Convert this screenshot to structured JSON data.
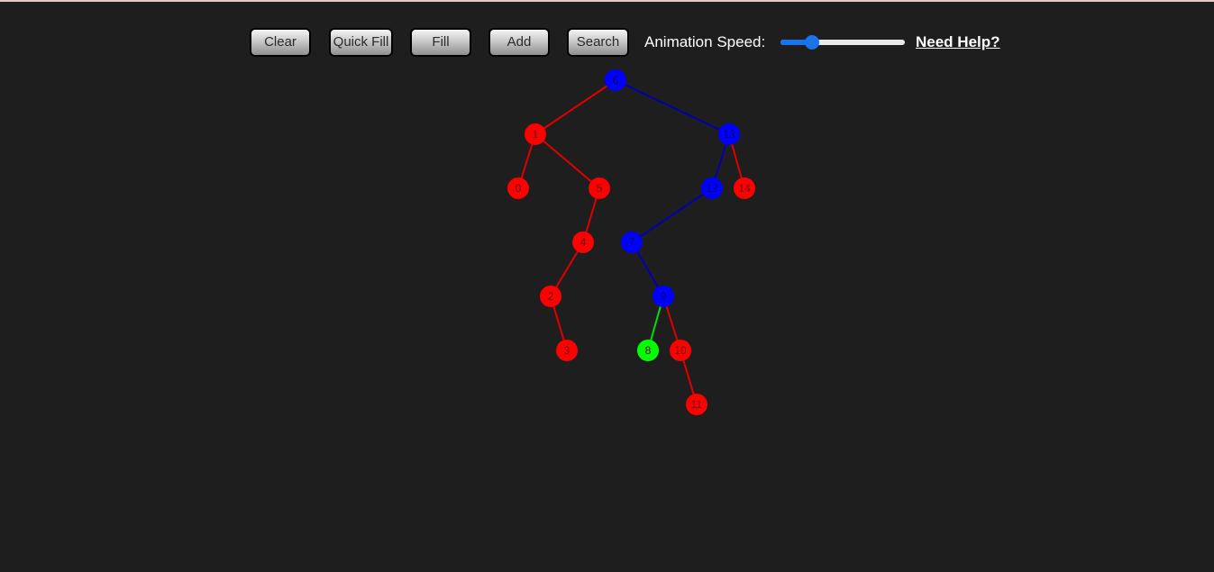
{
  "toolbar": {
    "buttons": {
      "clear": "Clear",
      "quick_fill": "Quick Fill",
      "fill": "Fill",
      "add": "Add",
      "search": "Search"
    },
    "speed_label": "Animation Speed:",
    "speed_value": 0.25,
    "help_link": "Need Help?"
  },
  "colors": {
    "background": "#1e1e1e",
    "red": "#ff0000",
    "blue": "#0000ff",
    "green": "#00ff00",
    "red_edge": "#e00000",
    "blue_edge": "#0000b0",
    "green_edge": "#00e000"
  },
  "tree": {
    "nodes": [
      {
        "id": "6",
        "label": "6",
        "color": "blue"
      },
      {
        "id": "1",
        "label": "1",
        "color": "red"
      },
      {
        "id": "13",
        "label": "13",
        "color": "blue"
      },
      {
        "id": "0",
        "label": "0",
        "color": "red"
      },
      {
        "id": "5",
        "label": "5",
        "color": "red"
      },
      {
        "id": "12",
        "label": "12",
        "color": "blue"
      },
      {
        "id": "14",
        "label": "14",
        "color": "red"
      },
      {
        "id": "4",
        "label": "4",
        "color": "red"
      },
      {
        "id": "7",
        "label": "7",
        "color": "blue"
      },
      {
        "id": "2",
        "label": "2",
        "color": "red"
      },
      {
        "id": "9",
        "label": "9",
        "color": "blue"
      },
      {
        "id": "3",
        "label": "3",
        "color": "red"
      },
      {
        "id": "8",
        "label": "8",
        "color": "green"
      },
      {
        "id": "10",
        "label": "10",
        "color": "red"
      },
      {
        "id": "11",
        "label": "11",
        "color": "red"
      }
    ],
    "edges": [
      {
        "from": "6",
        "to": "1",
        "color": "red"
      },
      {
        "from": "6",
        "to": "13",
        "color": "blue"
      },
      {
        "from": "1",
        "to": "0",
        "color": "red"
      },
      {
        "from": "1",
        "to": "5",
        "color": "red"
      },
      {
        "from": "5",
        "to": "4",
        "color": "red"
      },
      {
        "from": "4",
        "to": "2",
        "color": "red"
      },
      {
        "from": "2",
        "to": "3",
        "color": "red"
      },
      {
        "from": "13",
        "to": "12",
        "color": "blue"
      },
      {
        "from": "13",
        "to": "14",
        "color": "red"
      },
      {
        "from": "12",
        "to": "7",
        "color": "blue"
      },
      {
        "from": "7",
        "to": "9",
        "color": "blue"
      },
      {
        "from": "9",
        "to": "8",
        "color": "green"
      },
      {
        "from": "9",
        "to": "10",
        "color": "red"
      },
      {
        "from": "10",
        "to": "11",
        "color": "red"
      }
    ]
  }
}
